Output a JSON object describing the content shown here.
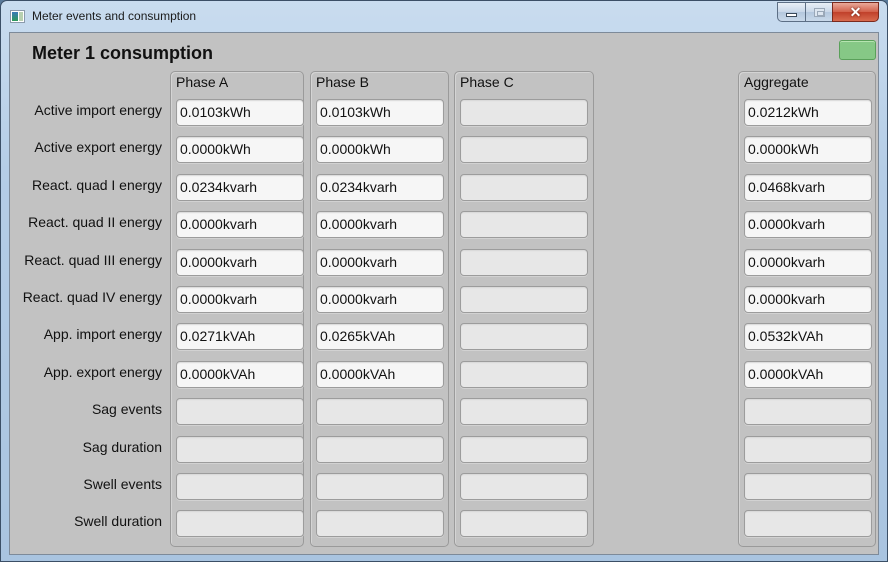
{
  "window": {
    "title": "Meter events and consumption",
    "controls": {
      "minimize": "minimize",
      "maximize": "maximize",
      "close": "close"
    }
  },
  "page": {
    "title": "Meter 1 consumption",
    "status_led_color": "#86c886"
  },
  "row_labels": [
    "Active import energy",
    "Active export energy",
    "React. quad I energy",
    "React. quad II energy",
    "React. quad III energy",
    "React. quad IV energy",
    "App. import energy",
    "App. export energy",
    "Sag events",
    "Sag duration",
    "Swell events",
    "Swell duration"
  ],
  "groups": [
    {
      "title": "Phase A",
      "values": [
        "0.0103kWh",
        "0.0000kWh",
        "0.0234kvarh",
        "0.0000kvarh",
        "0.0000kvarh",
        "0.0000kvarh",
        "0.0271kVAh",
        "0.0000kVAh",
        "",
        "",
        "",
        ""
      ]
    },
    {
      "title": "Phase B",
      "values": [
        "0.0103kWh",
        "0.0000kWh",
        "0.0234kvarh",
        "0.0000kvarh",
        "0.0000kvarh",
        "0.0000kvarh",
        "0.0265kVAh",
        "0.0000kVAh",
        "",
        "",
        "",
        ""
      ]
    },
    {
      "title": "Phase C",
      "values": [
        "",
        "",
        "",
        "",
        "",
        "",
        "",
        "",
        "",
        "",
        "",
        ""
      ]
    },
    {
      "title": "Aggregate",
      "values": [
        "0.0212kWh",
        "0.0000kWh",
        "0.0468kvarh",
        "0.0000kvarh",
        "0.0000kvarh",
        "0.0000kvarh",
        "0.0532kVAh",
        "0.0000kVAh",
        "",
        "",
        "",
        ""
      ]
    }
  ]
}
